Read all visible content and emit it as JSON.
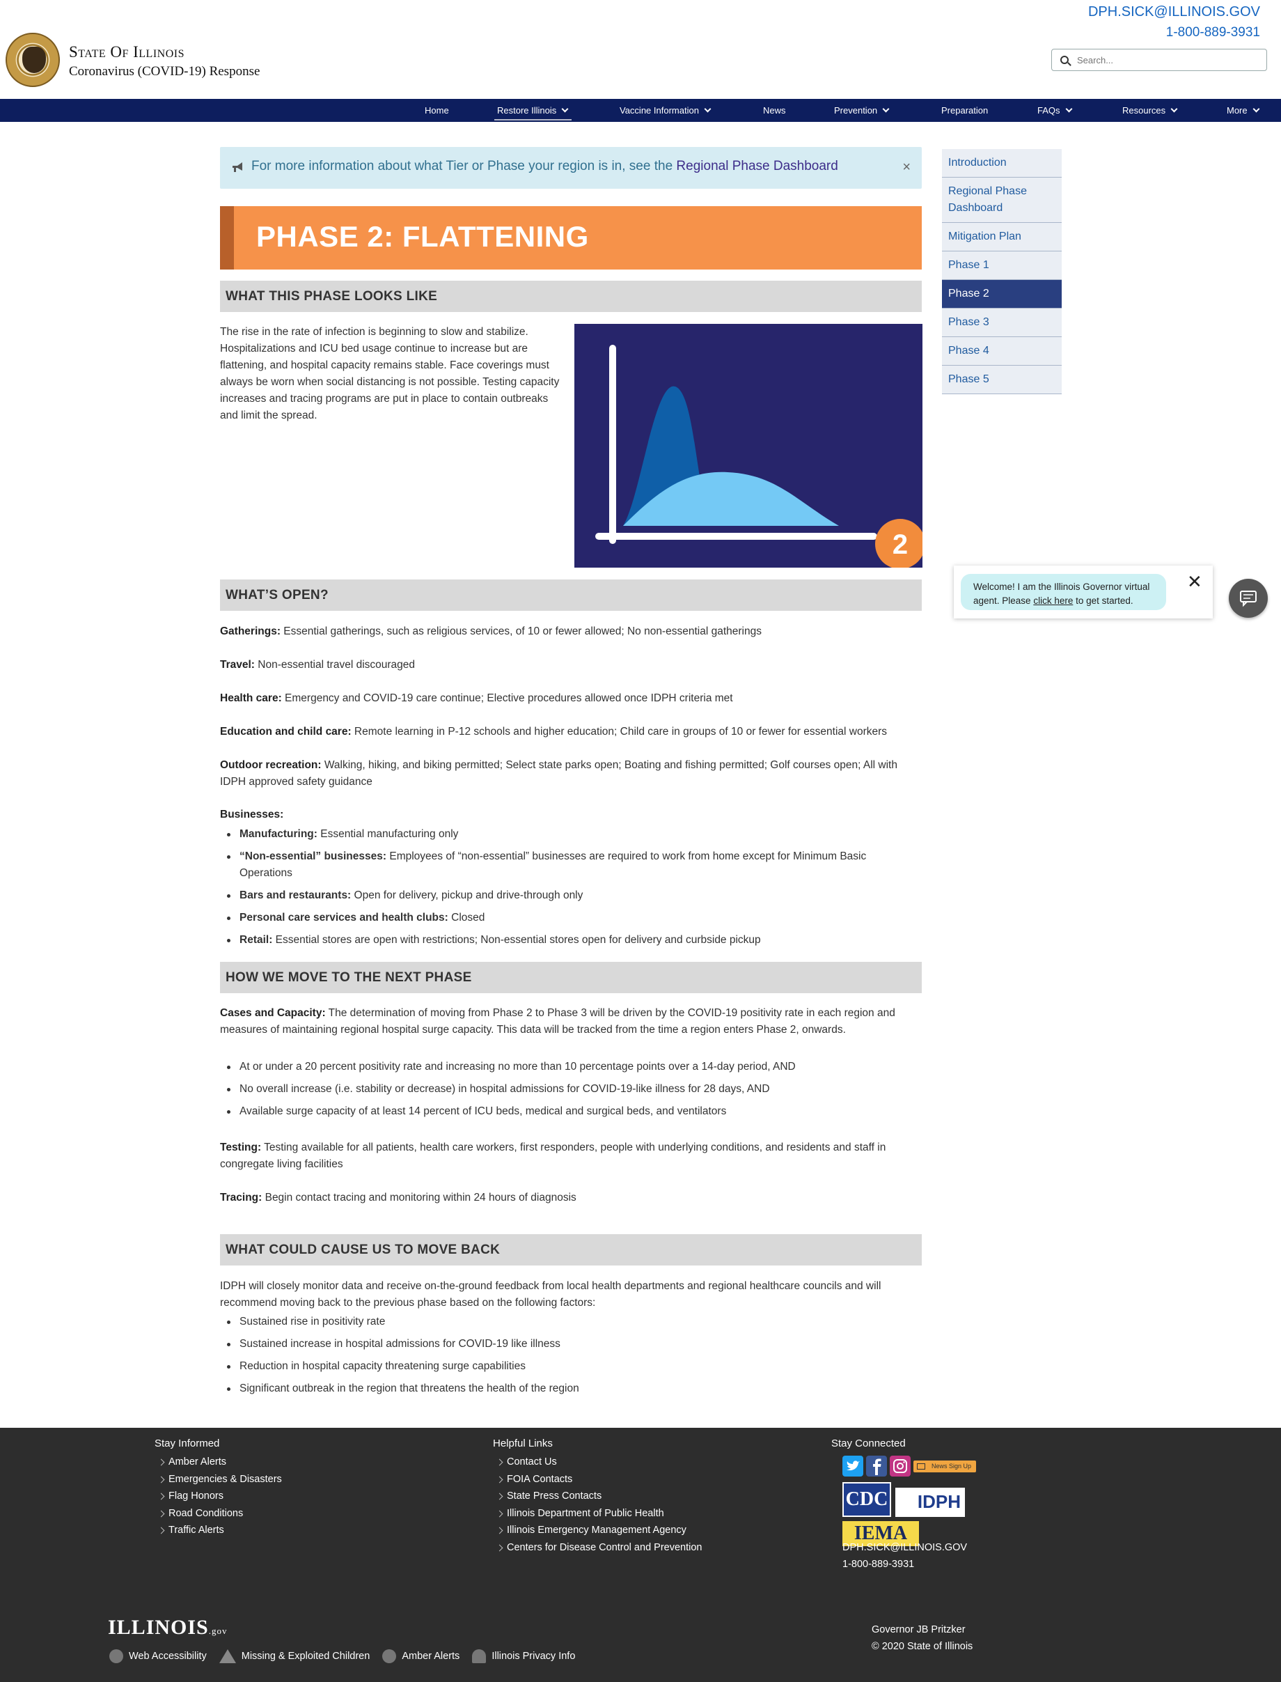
{
  "header": {
    "email": "DPH.SICK@ILLINOIS.GOV",
    "phone": "1-800-889-3931",
    "state_title": "State Of Illinois",
    "subtitle": "Coronavirus (COVID-19) Response",
    "search_placeholder": "Search..."
  },
  "nav": {
    "items": [
      {
        "label": "Home"
      },
      {
        "label": "Restore Illinois"
      },
      {
        "label": "Vaccine Information"
      },
      {
        "label": "News"
      },
      {
        "label": "Prevention"
      },
      {
        "label": "Preparation"
      },
      {
        "label": "FAQs"
      },
      {
        "label": "Resources"
      },
      {
        "label": "More"
      }
    ]
  },
  "alert": {
    "text": "For more information about what Tier or Phase your region is in, see the ",
    "link": "Regional Phase Dashboard",
    "close": "×"
  },
  "banner": {
    "title": "PHASE 2: FLATTENING"
  },
  "sections": {
    "looks_like": {
      "heading": "WHAT THIS PHASE LOOKS LIKE",
      "body": "The rise in the rate of infection is beginning to slow and stabilize. Hospitalizations and ICU bed usage continue to increase but are flattening, and hospital capacity remains stable. Face coverings must always be worn when social distancing is not possible. Testing capacity increases and tracing programs are put in place to contain outbreaks and limit the spread.",
      "graphic_badge": "2"
    },
    "whats_open": {
      "heading": "WHAT’S OPEN?",
      "items": [
        {
          "label": "Gatherings:",
          "text": " Essential gatherings, such as religious services, of 10 or fewer allowed; No non-essential gatherings"
        },
        {
          "label": "Travel:",
          "text": " Non-essential travel discouraged"
        },
        {
          "label": "Health care:",
          "text": " Emergency and COVID-19 care continue; Elective procedures allowed once IDPH criteria met"
        },
        {
          "label": "Education and child care:",
          "text": " Remote learning in P-12 schools and higher education; Child care in groups of 10 or fewer for essential workers"
        },
        {
          "label": "Outdoor recreation:",
          "text": " Walking, hiking, and biking permitted; Select state parks open; Boating and fishing permitted; Golf courses open; All with IDPH approved safety guidance"
        }
      ],
      "businesses_label": "Businesses:",
      "businesses": [
        {
          "label": "Manufacturing:",
          "text": " Essential manufacturing only"
        },
        {
          "label": "“Non-essential” businesses:",
          "text": " Employees of “non-essential” businesses are required to work from home except for Minimum Basic Operations"
        },
        {
          "label": "Bars and restaurants:",
          "text": " Open for delivery, pickup and drive-through only"
        },
        {
          "label": "Personal care services and health clubs:",
          "text": " Closed"
        },
        {
          "label": "Retail:",
          "text": " Essential stores are open with restrictions; Non-essential stores open for delivery and curbside pickup"
        }
      ]
    },
    "next_phase": {
      "heading": "HOW WE MOVE TO THE NEXT PHASE",
      "cases_label": "Cases and Capacity:",
      "cases_text": " The determination of moving from Phase 2 to Phase 3 will be driven by the COVID-19 positivity rate in each region and measures of maintaining regional hospital surge capacity. This data will be tracked from the time a region enters Phase 2, onwards.",
      "criteria": [
        "At or under a 20 percent positivity rate and increasing no more than 10 percentage points over a 14-day period, AND",
        "No overall increase (i.e. stability or decrease) in hospital admissions for COVID-19-like illness for 28 days, AND",
        "Available surge capacity of at least 14 percent of ICU beds, medical and surgical beds, and ventilators"
      ],
      "testing_label": "Testing:",
      "testing_text": " Testing available for all patients, health care workers, first responders, people with underlying conditions, and residents and staff in congregate living facilities",
      "tracing_label": "Tracing:",
      "tracing_text": " Begin contact tracing and monitoring within 24 hours of diagnosis"
    },
    "move_back": {
      "heading": "WHAT COULD CAUSE US TO MOVE BACK",
      "intro": "IDPH will closely monitor data and receive on-the-ground feedback from local health departments and regional healthcare councils and will recommend moving back to the previous phase based on the following factors:",
      "factors": [
        "Sustained rise in positivity rate",
        "Sustained increase in hospital admissions for COVID-19 like illness",
        "Reduction in hospital capacity threatening surge capabilities",
        "Significant outbreak in the region that threatens the health of the region"
      ]
    }
  },
  "sidemenu": [
    {
      "label": "Introduction"
    },
    {
      "label": "Regional Phase Dashboard"
    },
    {
      "label": "Mitigation Plan"
    },
    {
      "label": "Phase 1"
    },
    {
      "label": "Phase 2"
    },
    {
      "label": "Phase 3"
    },
    {
      "label": "Phase 4"
    },
    {
      "label": "Phase 5"
    }
  ],
  "chat": {
    "message_pre": "Welcome! I am the Illinois Governor virtual agent. Please ",
    "message_link": "click here",
    "message_post": " to get started.",
    "close": "✕"
  },
  "footer": {
    "stay_informed": {
      "heading": "Stay Informed",
      "links": [
        "Amber Alerts",
        "Emergencies & Disasters",
        "Flag Honors",
        "Road Conditions",
        "Traffic Alerts"
      ]
    },
    "helpful_links": {
      "heading": "Helpful Links",
      "links": [
        "Contact Us",
        "FOIA Contacts",
        "State Press Contacts",
        "Illinois Department of Public Health",
        "Illinois Emergency Management Agency",
        "Centers for Disease Control and Prevention"
      ]
    },
    "stay_connected": {
      "heading": "Stay Connected",
      "news_signup": "News Sign Up",
      "cdc": "CDC",
      "idph": "IDPH",
      "iema": "IEMA",
      "email": "DPH.SICK@ILLINOIS.GOV",
      "phone": "1-800-889-3931"
    },
    "governor": "Governor JB Pritzker",
    "copyright": "© 2020 State of Illinois",
    "brand": "ILLINOIS",
    "brand_suffix": ".gov",
    "bottom_links": [
      "Web Accessibility",
      "Missing & Exploited Children",
      "Amber Alerts",
      "Illinois Privacy Info"
    ]
  },
  "colors": {
    "nav_bg": "#0d1e5e",
    "banner": "#f6924a",
    "graphic_bg": "#27256b",
    "active_menu": "#293f80",
    "footer_bg": "#2d2d2d"
  }
}
